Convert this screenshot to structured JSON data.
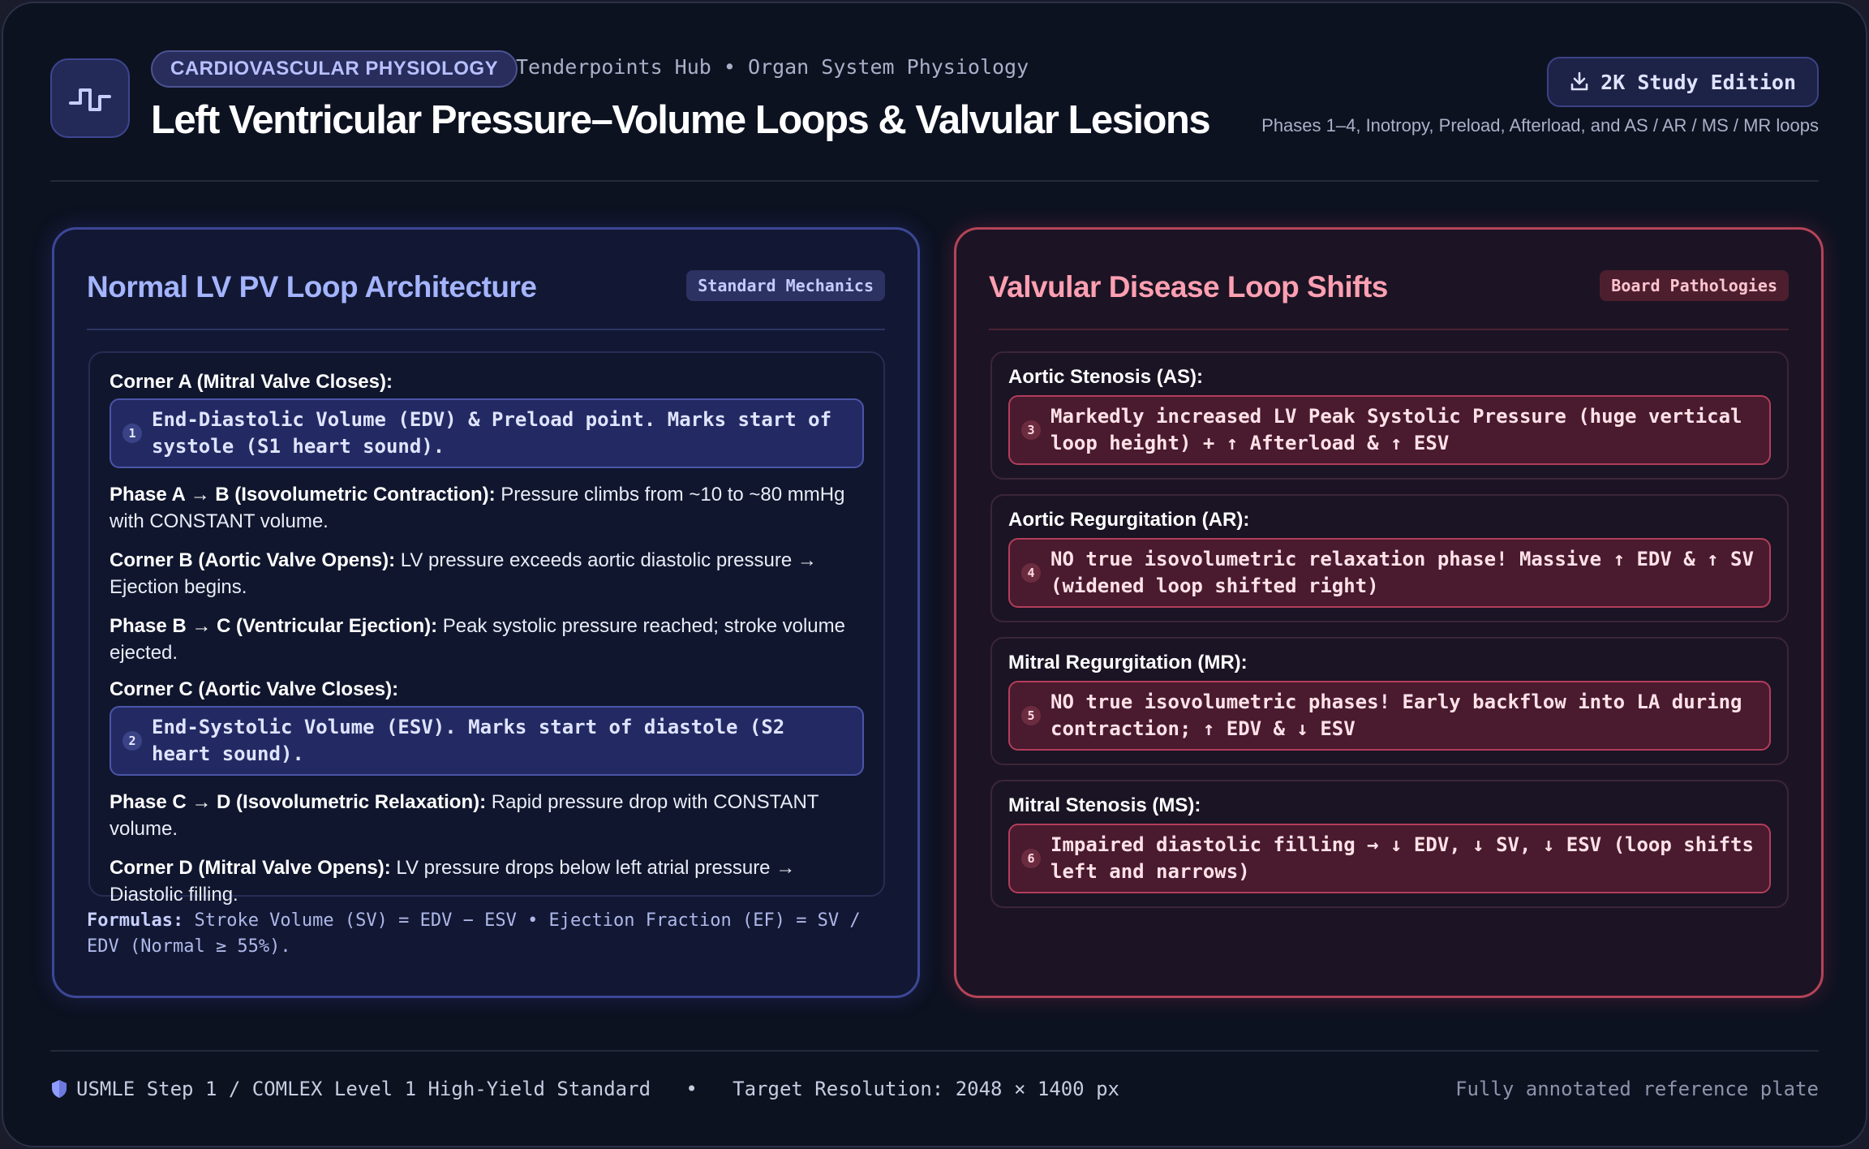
{
  "header": {
    "tag": "CARDIOVASCULAR PHYSIOLOGY",
    "breadcrumb": "Tenderpoints Hub • Organ System Physiology",
    "title": "Left Ventricular Pressure–Volume Loops & Valvular Lesions",
    "edition_button": "2K Study Edition",
    "subtitle": "Phases 1–4, Inotropy, Preload, Afterload, and AS / AR / MS / MR loops",
    "icons": {
      "logo": "pulse-waveform-icon",
      "edition": "download-icon"
    }
  },
  "left_panel": {
    "title": "Normal LV PV Loop Architecture",
    "badge": "Standard Mechanics",
    "corner_a": {
      "head": "Corner A (Mitral Valve Closes):",
      "num": "1",
      "text": "End-Diastolic Volume (EDV) & Preload point. Marks start of systole (S1 heart sound)."
    },
    "phase_ab": {
      "head": "Phase A → B (Isovolumetric Contraction):",
      "text": " Pressure climbs from ~10 to ~80 mmHg with CONSTANT volume."
    },
    "corner_b": {
      "head": "Corner B (Aortic Valve Opens):",
      "text": " LV pressure exceeds aortic diastolic pressure → Ejection begins."
    },
    "phase_bc": {
      "head": "Phase B → C (Ventricular Ejection):",
      "text": " Peak systolic pressure reached; stroke volume ejected."
    },
    "corner_c": {
      "head": "Corner C (Aortic Valve Closes):",
      "num": "2",
      "text": "End-Systolic Volume (ESV). Marks start of diastole (S2 heart sound)."
    },
    "phase_cd": {
      "head": "Phase C → D (Isovolumetric Relaxation):",
      "text": " Rapid pressure drop with CONSTANT volume."
    },
    "corner_d": {
      "head": "Corner D (Mitral Valve Opens):",
      "text": " LV pressure drops below left atrial pressure → Diastolic filling."
    },
    "formula_label": "Formulas:",
    "formula_text": " Stroke Volume (SV) = EDV − ESV • Ejection Fraction (EF) = SV / EDV (Normal ≥ 55%)."
  },
  "right_panel": {
    "title": "Valvular Disease Loop Shifts",
    "badge": "Board Pathologies",
    "cards": [
      {
        "head": "Aortic Stenosis (AS):",
        "num": "3",
        "text": "Markedly increased LV Peak Systolic Pressure (huge vertical loop height) + ↑ Afterload & ↑ ESV"
      },
      {
        "head": "Aortic Regurgitation (AR):",
        "num": "4",
        "text": "NO true isovolumetric relaxation phase! Massive ↑ EDV & ↑ SV (widened loop shifted right)"
      },
      {
        "head": "Mitral Regurgitation (MR):",
        "num": "5",
        "text": "NO true isovolumetric phases! Early backflow into LA during contraction; ↑ EDV & ↓ ESV"
      },
      {
        "head": "Mitral Stenosis (MS):",
        "num": "6",
        "text": "Impaired diastolic filling → ↓ EDV, ↓ SV, ↓ ESV (loop shifts left and narrows)"
      }
    ]
  },
  "footer": {
    "left": "USMLE Step 1 / COMLEX Level 1 High-Yield Standard   •   Target Resolution: 2048 × 1400 px",
    "right": "Fully annotated reference plate",
    "icon": "shield-icon"
  },
  "colors": {
    "background": "#0d1221",
    "accent_blue": "#a4b4ff",
    "accent_red": "#ff9fb2",
    "blue_border": "#3d4796",
    "red_border": "#b54458"
  }
}
